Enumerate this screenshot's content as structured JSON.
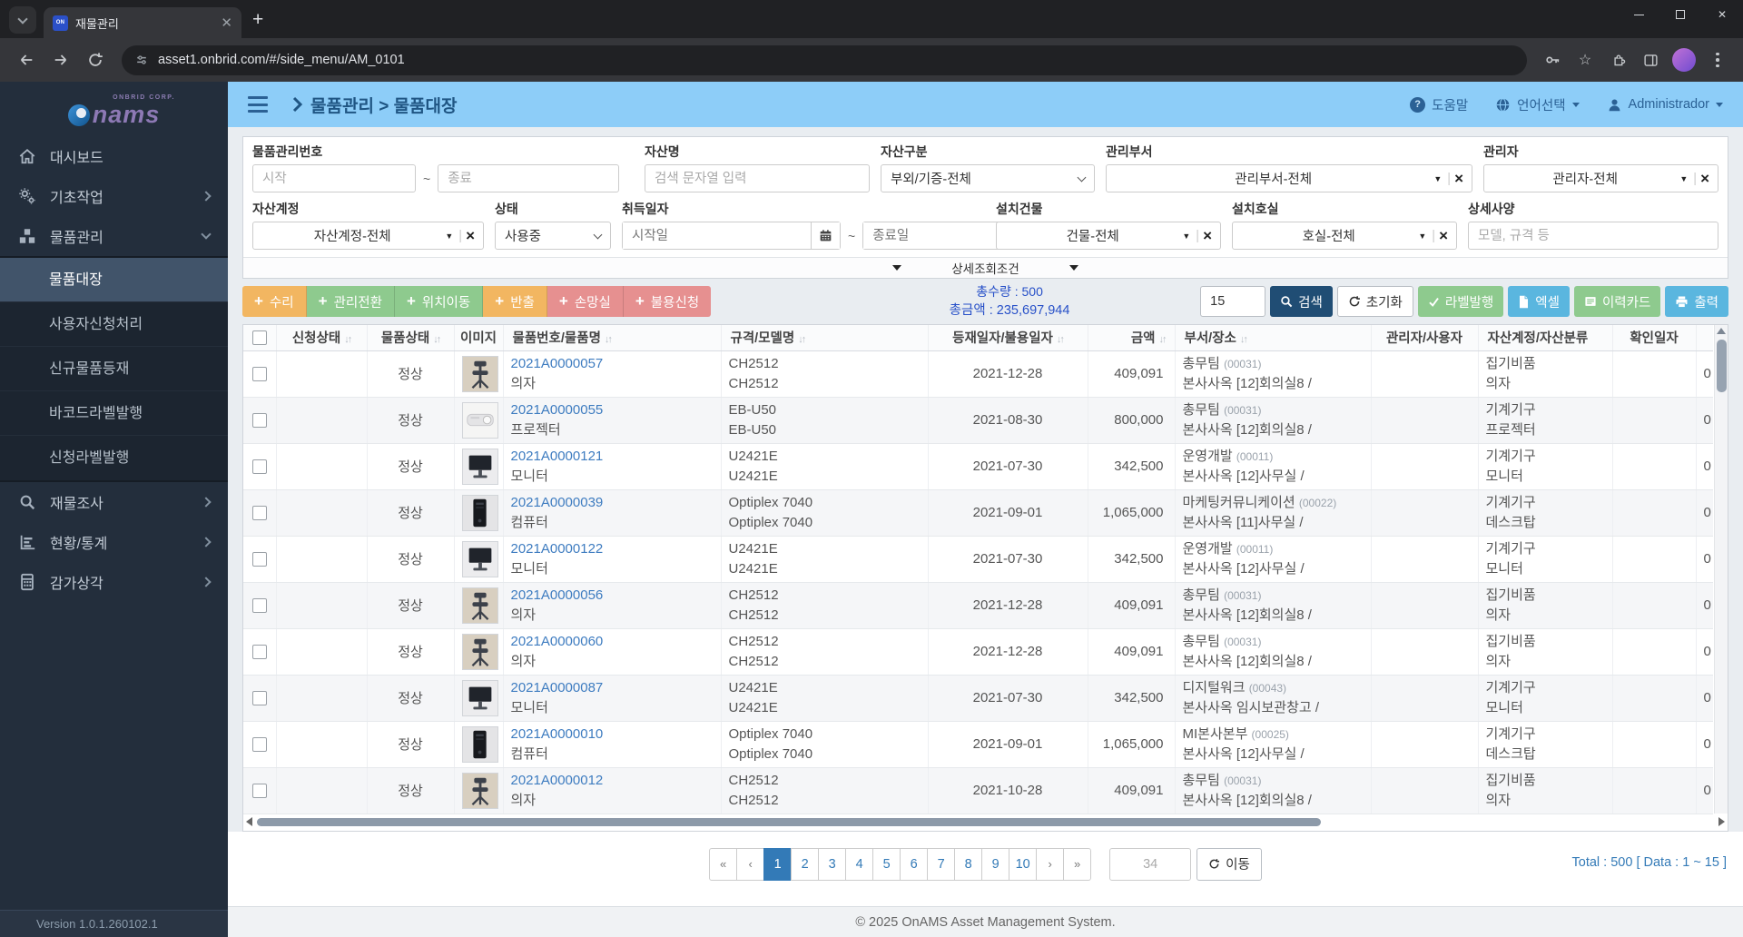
{
  "browser": {
    "tab_title": "재물관리",
    "favicon_text": "ON",
    "url": "asset1.onbrid.com/#/side_menu/AM_0101"
  },
  "sidebar": {
    "logo_sub": "ONBRID CORP.",
    "logo_text": "nams",
    "items_top": [
      {
        "label": "대시보드",
        "icon": "home"
      },
      {
        "label": "기초작업",
        "icon": "gears"
      },
      {
        "label": "물품관리",
        "icon": "boxes"
      }
    ],
    "subitems": [
      {
        "label": "물품대장",
        "active": true
      },
      {
        "label": "사용자신청처리",
        "active": false
      },
      {
        "label": "신규물품등재",
        "active": false
      },
      {
        "label": "바코드라벨발행",
        "active": false
      },
      {
        "label": "신청라벨발행",
        "active": false
      }
    ],
    "items_bottom": [
      {
        "label": "재물조사",
        "icon": "search"
      },
      {
        "label": "현황/통계",
        "icon": "chart"
      },
      {
        "label": "감가상각",
        "icon": "calculator"
      }
    ],
    "version": "Version 1.0.1.260102.1"
  },
  "header": {
    "breadcrumb": "물품관리 > 물품대장",
    "help_label": "도움말",
    "language_label": "언어선택",
    "user_label": "Administrador"
  },
  "filters": {
    "item_no_label": "물품관리번호",
    "item_no_start_ph": "시작",
    "item_no_end_ph": "종료",
    "tilde": "~",
    "asset_name_label": "자산명",
    "asset_name_ph": "검색 문자열 입력",
    "asset_type_label": "자산구분",
    "asset_type_value": "부외/기증-전체",
    "dept_label": "관리부서",
    "dept_value": "관리부서-전체",
    "manager_label": "관리자",
    "manager_value": "관리자-전체",
    "account_label": "자산계정",
    "account_value": "자산계정-전체",
    "status_label": "상태",
    "status_value": "사용중",
    "acq_date_label": "취득일자",
    "acq_start_ph": "시작일",
    "acq_end_ph": "종료일",
    "building_label": "설치건물",
    "building_value": "건물-전체",
    "room_label": "설치호실",
    "room_value": "호실-전체",
    "spec_label": "상세사양",
    "spec_ph": "모델, 규격 등",
    "detail_toggle_label": "상세조회조건"
  },
  "actions": {
    "left_buttons": [
      {
        "label": "수리",
        "color": "#f2b661"
      },
      {
        "label": "관리전환",
        "color": "#8eca8e"
      },
      {
        "label": "위치이동",
        "color": "#8eca8e"
      },
      {
        "label": "반출",
        "color": "#f2b661"
      },
      {
        "label": "손망실",
        "color": "#e69090"
      },
      {
        "label": "불용신청",
        "color": "#e69090"
      }
    ],
    "total_qty": "총수량 : 500",
    "total_amount": "총금액 : 235,697,944",
    "page_size": "15",
    "search_label": "검색",
    "reset_label": "초기화",
    "label_print_label": "라벨발행",
    "excel_label": "엑셀",
    "history_label": "이력카드",
    "print_label": "출력"
  },
  "table": {
    "headers": [
      "신청상태",
      "물품상태",
      "이미지",
      "물품번호/물품명",
      "규격/모델명",
      "등재일자/불용일자",
      "금액",
      "부서/장소",
      "관리자/사용자",
      "자산계정/자산분류",
      "확인일자"
    ],
    "rows": [
      {
        "status": "정상",
        "img": "chair",
        "no": "2021A0000057",
        "name": "의자",
        "spec1": "CH2512",
        "spec2": "CH2512",
        "date": "2021-12-28",
        "amount": "409,091",
        "dept": "총무팀",
        "dept_code": "(00031)",
        "location": "본사사옥 [12]회의실8 /",
        "account": "집기비품",
        "category": "의자",
        "confirm_count": "0"
      },
      {
        "status": "정상",
        "img": "projector",
        "no": "2021A0000055",
        "name": "프로젝터",
        "spec1": "EB-U50",
        "spec2": "EB-U50",
        "date": "2021-08-30",
        "amount": "800,000",
        "dept": "총무팀",
        "dept_code": "(00031)",
        "location": "본사사옥 [12]회의실8 /",
        "account": "기계기구",
        "category": "프로젝터",
        "confirm_count": "0"
      },
      {
        "status": "정상",
        "img": "monitor",
        "no": "2021A0000121",
        "name": "모니터",
        "spec1": "U2421E",
        "spec2": "U2421E",
        "date": "2021-07-30",
        "amount": "342,500",
        "dept": "운영개발",
        "dept_code": "(00011)",
        "location": "본사사옥 [12]사무실 /",
        "account": "기계기구",
        "category": "모니터",
        "confirm_count": "0"
      },
      {
        "status": "정상",
        "img": "desktop",
        "no": "2021A0000039",
        "name": "컴퓨터",
        "spec1": "Optiplex 7040",
        "spec2": "Optiplex 7040",
        "date": "2021-09-01",
        "amount": "1,065,000",
        "dept": "마케팅커뮤니케이션",
        "dept_code": "(00022)",
        "location": "본사사옥 [11]사무실 /",
        "account": "기계기구",
        "category": "데스크탑",
        "confirm_count": "0"
      },
      {
        "status": "정상",
        "img": "monitor",
        "no": "2021A0000122",
        "name": "모니터",
        "spec1": "U2421E",
        "spec2": "U2421E",
        "date": "2021-07-30",
        "amount": "342,500",
        "dept": "운영개발",
        "dept_code": "(00011)",
        "location": "본사사옥 [12]사무실 /",
        "account": "기계기구",
        "category": "모니터",
        "confirm_count": "0"
      },
      {
        "status": "정상",
        "img": "chair",
        "no": "2021A0000056",
        "name": "의자",
        "spec1": "CH2512",
        "spec2": "CH2512",
        "date": "2021-12-28",
        "amount": "409,091",
        "dept": "총무팀",
        "dept_code": "(00031)",
        "location": "본사사옥 [12]회의실8 /",
        "account": "집기비품",
        "category": "의자",
        "confirm_count": "0"
      },
      {
        "status": "정상",
        "img": "chair",
        "no": "2021A0000060",
        "name": "의자",
        "spec1": "CH2512",
        "spec2": "CH2512",
        "date": "2021-12-28",
        "amount": "409,091",
        "dept": "총무팀",
        "dept_code": "(00031)",
        "location": "본사사옥 [12]회의실8 /",
        "account": "집기비품",
        "category": "의자",
        "confirm_count": "0"
      },
      {
        "status": "정상",
        "img": "monitor",
        "no": "2021A0000087",
        "name": "모니터",
        "spec1": "U2421E",
        "spec2": "U2421E",
        "date": "2021-07-30",
        "amount": "342,500",
        "dept": "디지털워크",
        "dept_code": "(00043)",
        "location": "본사사옥 임시보관창고 /",
        "account": "기계기구",
        "category": "모니터",
        "confirm_count": "0"
      },
      {
        "status": "정상",
        "img": "desktop",
        "no": "2021A0000010",
        "name": "컴퓨터",
        "spec1": "Optiplex 7040",
        "spec2": "Optiplex 7040",
        "date": "2021-09-01",
        "amount": "1,065,000",
        "dept": "MI본사본부",
        "dept_code": "(00025)",
        "location": "본사사옥 [12]사무실 /",
        "account": "기계기구",
        "category": "데스크탑",
        "confirm_count": "0"
      },
      {
        "status": "정상",
        "img": "chair",
        "no": "2021A0000012",
        "name": "의자",
        "spec1": "CH2512",
        "spec2": "CH2512",
        "date": "2021-10-28",
        "amount": "409,091",
        "dept": "총무팀",
        "dept_code": "(00031)",
        "location": "본사사옥 [12]회의실8 /",
        "account": "집기비품",
        "category": "의자",
        "confirm_count": "0"
      }
    ]
  },
  "pagination": {
    "items": [
      "«",
      "‹",
      "1",
      "2",
      "3",
      "4",
      "5",
      "6",
      "7",
      "8",
      "9",
      "10",
      "›",
      "»"
    ],
    "active": "1",
    "goto_value": "34",
    "go_label": "이동",
    "total_label": "Total : 500 [ Data : 1 ~ 15 ]"
  },
  "footer": {
    "copyright": "© 2025 OnAMS Asset Management System."
  }
}
